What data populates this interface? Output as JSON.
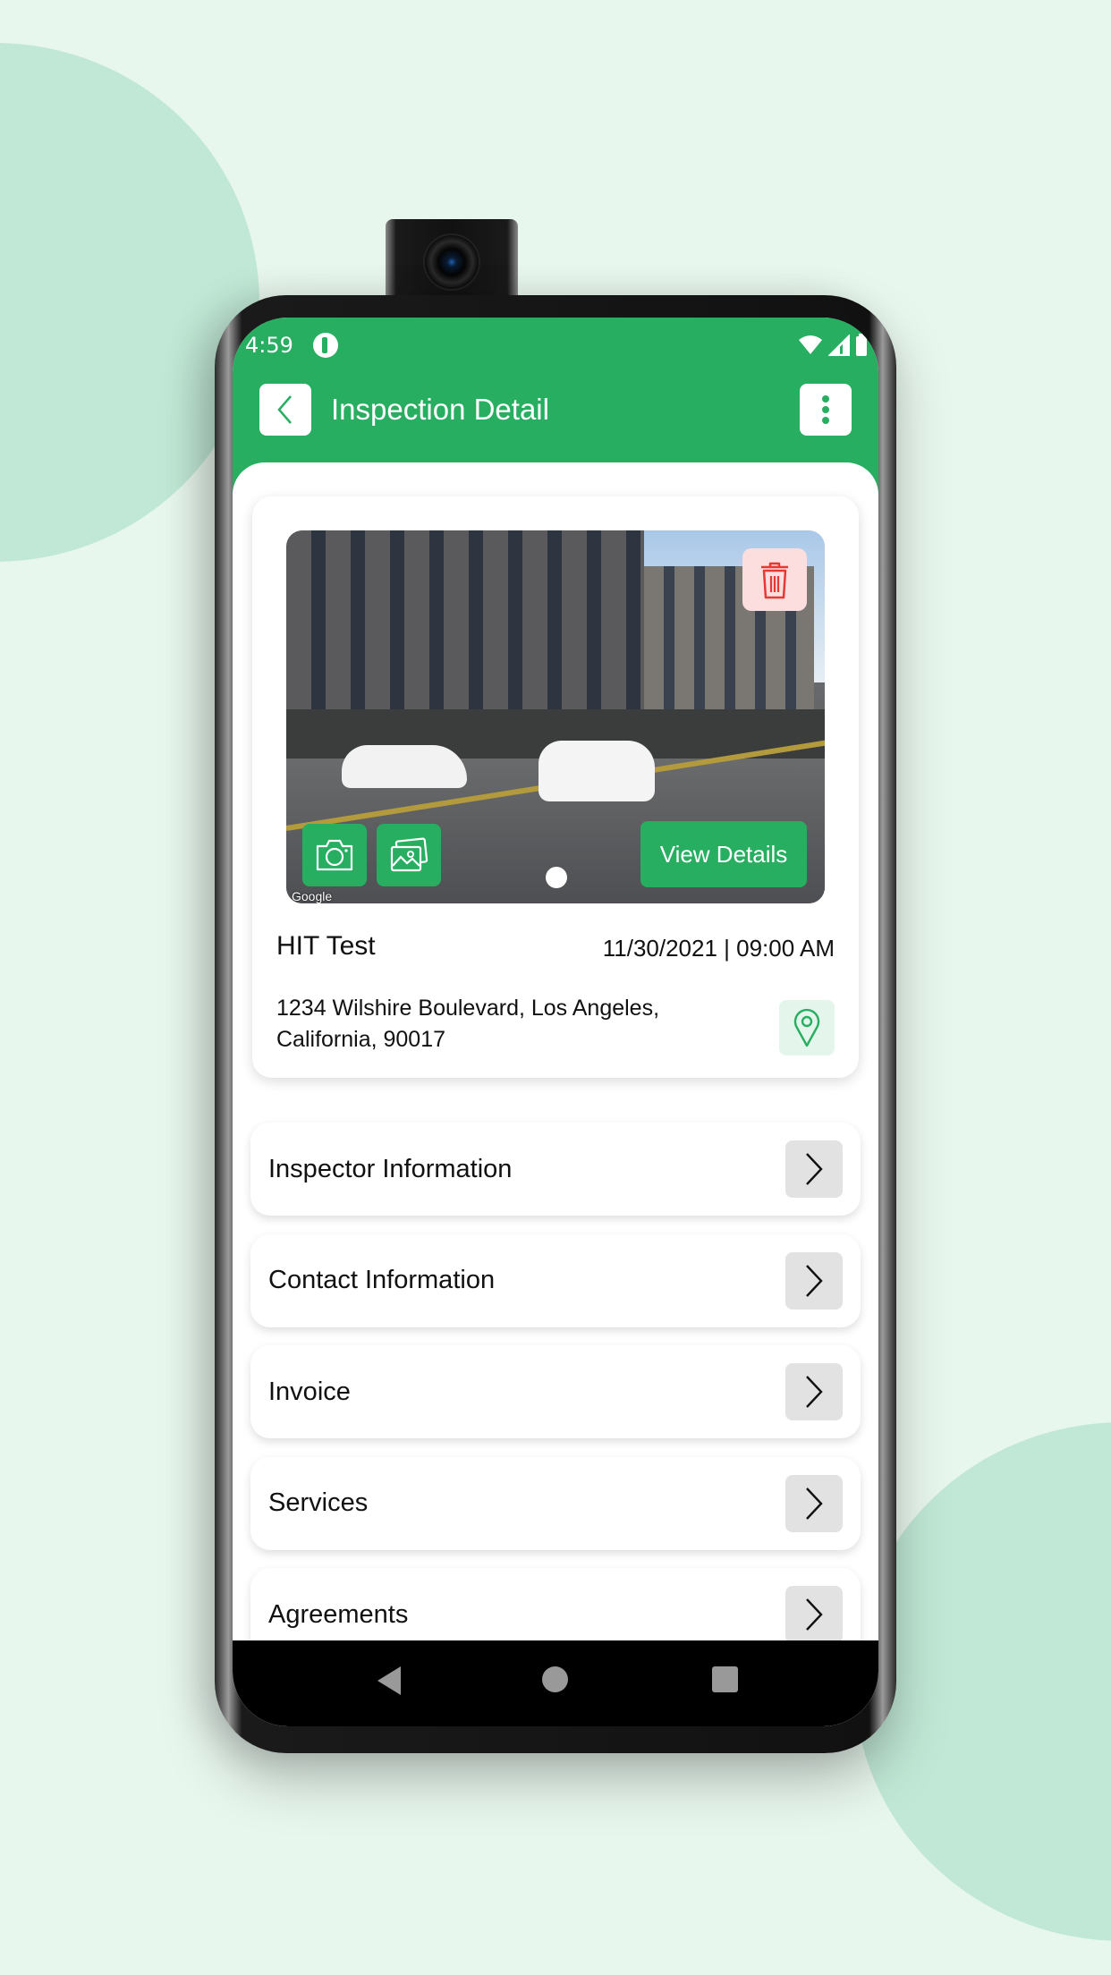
{
  "status_bar": {
    "time": "4:59",
    "icons": [
      "app-notification-icon",
      "wifi-icon",
      "cell-signal-icon",
      "battery-icon"
    ]
  },
  "toolbar": {
    "back_icon": "chevron-left-icon",
    "title": "Inspection Detail",
    "menu_icon": "more-vertical-icon"
  },
  "inspection": {
    "photo": {
      "watermark": "Google",
      "delete_icon": "trash-icon",
      "camera_icon": "camera-icon",
      "gallery_icon": "image-gallery-icon",
      "view_details_label": "View Details",
      "page_count": 1,
      "current_page": 1
    },
    "name": "HIT Test",
    "datetime": "11/30/2021 | 09:00 AM",
    "address": "1234 Wilshire Boulevard, Los Angeles, California, 90017",
    "map_icon": "map-pin-icon"
  },
  "sections": [
    {
      "label": "Inspector Information",
      "icon": "chevron-right-icon"
    },
    {
      "label": "Contact Information",
      "icon": "chevron-right-icon"
    },
    {
      "label": "Invoice",
      "icon": "chevron-right-icon"
    },
    {
      "label": "Services",
      "icon": "chevron-right-icon"
    },
    {
      "label": "Agreements",
      "icon": "chevron-right-icon"
    }
  ],
  "nav_bar": {
    "buttons": [
      "back",
      "home",
      "recents"
    ]
  },
  "colors": {
    "brand_green": "#27AE60",
    "background": "#E8F7EE",
    "delete_bg": "#FDDEDE",
    "delete_icon": "#E53935",
    "map_pin_bg": "#E4F5EB"
  }
}
